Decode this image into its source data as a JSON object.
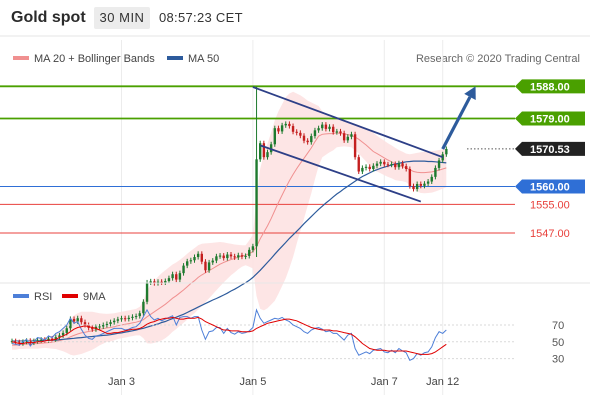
{
  "header": {
    "instrument": "Gold spot",
    "timeframe": "30 MIN",
    "time": "08:57:23 CET"
  },
  "legend": {
    "ma20_bb": "MA 20 + Bollinger Bands",
    "ma50": "MA 50",
    "research": "Research © 2020 Trading Central"
  },
  "rsi_legend": {
    "rsi": "RSI",
    "ma9": "9MA"
  },
  "colors": {
    "resistance": "#4aa000",
    "support_blue": "#2f6fd6",
    "support_red": "#e8413c",
    "candle_up": "#1e7a2e",
    "candle_down": "#c41e1e",
    "ma20": "#f09090",
    "ma50": "#2d5b9c",
    "channel": "#2d3f87",
    "arrow": "#2d5b9c",
    "bollinger_fill": "#fde1e1",
    "rsi_line": "#4d7fd8",
    "rsi_ma": "#e00000"
  },
  "chart_data": [
    {
      "type": "candlestick",
      "title": "Gold spot",
      "ylim": [
        1535,
        1592
      ],
      "levels": [
        {
          "value": 1588.0,
          "label": "1588.00",
          "kind": "resistance"
        },
        {
          "value": 1579.0,
          "label": "1579.00",
          "kind": "resistance"
        },
        {
          "value": 1570.53,
          "label": "1570.53",
          "kind": "last"
        },
        {
          "value": 1560.0,
          "label": "1560.00",
          "kind": "support_blue"
        },
        {
          "value": 1555.0,
          "label": "1555.00",
          "kind": "support_red"
        },
        {
          "value": 1547.0,
          "label": "1547.00",
          "kind": "support_red"
        }
      ],
      "x_ticks": [
        {
          "index": 30,
          "label": "Jan 3"
        },
        {
          "index": 66,
          "label": "Jan 5"
        },
        {
          "index": 102,
          "label": "Jan 7"
        },
        {
          "index": 118,
          "label": "Jan 12"
        }
      ],
      "close": [
        1516.8,
        1516.5,
        1516.2,
        1516.6,
        1516.9,
        1516.4,
        1516.8,
        1517.0,
        1517.2,
        1517.0,
        1517.5,
        1517.3,
        1517.9,
        1518.4,
        1519.1,
        1520.4,
        1523.0,
        1522.3,
        1523.2,
        1522.1,
        1521.3,
        1520.5,
        1520.1,
        1520.8,
        1520.9,
        1521.3,
        1521.6,
        1522.1,
        1522.5,
        1522.9,
        1523.2,
        1523.0,
        1523.3,
        1523.6,
        1523.8,
        1524.6,
        1527.8,
        1533.2,
        1533.5,
        1533.0,
        1533.4,
        1533.2,
        1533.6,
        1534.4,
        1535.5,
        1534.0,
        1535.8,
        1537.9,
        1539.1,
        1539.4,
        1540.3,
        1541.2,
        1539.0,
        1536.6,
        1538.8,
        1539.3,
        1540.5,
        1540.7,
        1540.0,
        1541.0,
        1540.5,
        1540.2,
        1540.8,
        1540.4,
        1540.6,
        1542.3,
        1543.3,
        1567.6,
        1572.1,
        1568.2,
        1569.6,
        1571.8,
        1576.3,
        1575.4,
        1577.1,
        1577.5,
        1576.9,
        1575.3,
        1575.0,
        1574.2,
        1572.8,
        1572.4,
        1574.1,
        1575.7,
        1576.3,
        1577.3,
        1576.1,
        1576.7,
        1575.2,
        1575.4,
        1574.9,
        1572.9,
        1573.9,
        1574.6,
        1568.2,
        1564.2,
        1565.2,
        1565.5,
        1564.9,
        1565.8,
        1566.4,
        1566.9,
        1566.2,
        1566.1,
        1566.3,
        1565.4,
        1566.5,
        1565.7,
        1564.9,
        1560.1,
        1559.3,
        1560.7,
        1560.2,
        1560.8,
        1561.4,
        1562.7,
        1565.2,
        1567.3,
        1569.0,
        1570.5
      ],
      "ma20": [
        1515.7,
        1515.7,
        1515.8,
        1515.9,
        1516.0,
        1516.0,
        1516.1,
        1516.1,
        1516.2,
        1516.3,
        1516.4,
        1516.5,
        1516.7,
        1516.9,
        1517.2,
        1517.5,
        1518.0,
        1518.4,
        1518.8,
        1519.1,
        1519.3,
        1519.5,
        1519.7,
        1519.9,
        1520.1,
        1520.3,
        1520.5,
        1520.6,
        1520.8,
        1521.1,
        1521.3,
        1521.5,
        1521.7,
        1521.9,
        1522.1,
        1522.4,
        1522.8,
        1523.6,
        1524.3,
        1525.0,
        1525.7,
        1526.4,
        1527.1,
        1527.9,
        1528.8,
        1529.5,
        1530.3,
        1531.1,
        1532.0,
        1532.9,
        1533.7,
        1534.6,
        1535.3,
        1535.9,
        1536.5,
        1537.1,
        1537.7,
        1538.3,
        1538.8,
        1539.2,
        1539.6,
        1539.9,
        1540.3,
        1540.6,
        1540.8,
        1541.3,
        1541.8,
        1543.2,
        1545.4,
        1547.2,
        1549.0,
        1551.0,
        1553.3,
        1555.5,
        1557.6,
        1559.7,
        1561.6,
        1563.4,
        1565.0,
        1566.5,
        1567.9,
        1569.3,
        1570.8,
        1572.5,
        1574.1,
        1574.6,
        1574.7,
        1574.8,
        1574.8,
        1575.0,
        1574.8,
        1574.7,
        1574.5,
        1574.3,
        1573.8,
        1573.2,
        1572.4,
        1571.6,
        1570.7,
        1569.8,
        1569.2,
        1568.6,
        1568.0,
        1567.4,
        1566.9,
        1566.3,
        1565.9,
        1565.6,
        1565.2,
        1564.7,
        1564.2,
        1564.0,
        1563.9,
        1563.9,
        1564.0,
        1564.1,
        1564.3,
        1564.6,
        1564.9,
        1565.2
      ],
      "bb_upper": [
        1517.0,
        1517.0,
        1517.0,
        1517.2,
        1517.3,
        1517.3,
        1517.5,
        1517.5,
        1517.6,
        1517.7,
        1518.0,
        1518.3,
        1518.8,
        1519.5,
        1520.4,
        1521.5,
        1523.0,
        1524.0,
        1524.6,
        1525.0,
        1525.0,
        1525.0,
        1525.0,
        1524.8,
        1524.6,
        1524.5,
        1524.4,
        1524.5,
        1524.6,
        1524.8,
        1525.0,
        1525.2,
        1525.4,
        1525.6,
        1525.8,
        1526.4,
        1528.0,
        1531.0,
        1532.5,
        1533.7,
        1534.8,
        1535.8,
        1536.6,
        1537.4,
        1538.2,
        1538.8,
        1539.5,
        1540.3,
        1541.2,
        1542.0,
        1542.8,
        1543.6,
        1544.0,
        1544.1,
        1544.2,
        1544.3,
        1544.4,
        1544.5,
        1544.4,
        1544.2,
        1544.0,
        1543.8,
        1543.7,
        1543.6,
        1543.6,
        1545.0,
        1546.5,
        1557.0,
        1565.0,
        1569.0,
        1572.0,
        1575.0,
        1578.5,
        1581.0,
        1583.0,
        1585.0,
        1586.0,
        1586.5,
        1586.0,
        1585.5,
        1584.8,
        1584.0,
        1583.5,
        1583.0,
        1582.5,
        1581.0,
        1580.5,
        1580.0,
        1579.5,
        1579.0,
        1578.5,
        1578.2,
        1577.9,
        1577.6,
        1577.5,
        1577.2,
        1576.7,
        1576.2,
        1575.6,
        1575.0,
        1574.2,
        1573.5,
        1572.8,
        1572.1,
        1571.5,
        1570.8,
        1570.2,
        1569.7,
        1569.2,
        1569.0,
        1569.2,
        1569.4,
        1569.6,
        1569.7,
        1569.8,
        1569.9,
        1570.0,
        1570.2,
        1570.4,
        1570.6
      ],
      "bb_lower": [
        1514.4,
        1514.4,
        1514.6,
        1514.6,
        1514.7,
        1514.7,
        1514.7,
        1514.7,
        1514.8,
        1514.9,
        1514.8,
        1514.7,
        1514.6,
        1514.3,
        1514.0,
        1513.5,
        1513.0,
        1512.8,
        1513.0,
        1513.2,
        1513.6,
        1514.0,
        1514.4,
        1515.0,
        1515.6,
        1516.1,
        1516.6,
        1516.7,
        1517.0,
        1517.4,
        1517.6,
        1517.8,
        1518.0,
        1518.2,
        1518.4,
        1518.4,
        1517.6,
        1516.2,
        1516.1,
        1516.3,
        1516.6,
        1517.0,
        1517.6,
        1518.4,
        1519.4,
        1520.2,
        1521.1,
        1521.9,
        1522.8,
        1523.8,
        1524.6,
        1525.6,
        1526.6,
        1527.7,
        1528.8,
        1529.9,
        1531.0,
        1532.1,
        1533.2,
        1534.2,
        1535.2,
        1536.0,
        1536.9,
        1537.6,
        1538.0,
        1537.6,
        1537.1,
        1529.4,
        1525.8,
        1525.4,
        1526.0,
        1527.0,
        1528.1,
        1530.0,
        1532.2,
        1534.4,
        1537.2,
        1540.3,
        1544.0,
        1547.5,
        1551.0,
        1554.6,
        1558.1,
        1562.0,
        1565.7,
        1568.2,
        1568.9,
        1569.6,
        1570.1,
        1571.0,
        1571.1,
        1571.2,
        1571.1,
        1571.0,
        1570.1,
        1569.2,
        1568.1,
        1567.0,
        1565.8,
        1564.6,
        1564.2,
        1563.7,
        1563.2,
        1562.7,
        1562.3,
        1561.8,
        1561.6,
        1561.5,
        1561.2,
        1560.4,
        1559.2,
        1558.6,
        1558.2,
        1558.1,
        1558.2,
        1558.3,
        1558.6,
        1559.0,
        1559.4,
        1559.8
      ],
      "ma50": [
        1516.8,
        1516.8,
        1516.8,
        1516.8,
        1516.8,
        1516.8,
        1516.9,
        1516.9,
        1516.9,
        1517.0,
        1517.0,
        1517.1,
        1517.1,
        1517.2,
        1517.3,
        1517.4,
        1517.5,
        1517.6,
        1517.7,
        1517.8,
        1517.9,
        1518.0,
        1518.1,
        1518.2,
        1518.3,
        1518.4,
        1518.5,
        1518.6,
        1518.8,
        1519.0,
        1519.1,
        1519.3,
        1519.5,
        1519.7,
        1519.9,
        1520.2,
        1520.4,
        1520.7,
        1521.0,
        1521.3,
        1521.6,
        1522.0,
        1522.3,
        1522.7,
        1523.1,
        1523.5,
        1523.9,
        1524.3,
        1524.8,
        1525.3,
        1525.8,
        1526.3,
        1526.8,
        1527.3,
        1527.8,
        1528.3,
        1528.7,
        1529.2,
        1529.7,
        1530.2,
        1530.8,
        1531.3,
        1531.9,
        1532.5,
        1533.1,
        1533.8,
        1534.6,
        1535.6,
        1536.6,
        1537.7,
        1538.8,
        1539.9,
        1541.1,
        1542.2,
        1543.3,
        1544.4,
        1545.5,
        1546.5,
        1547.5,
        1548.5,
        1549.6,
        1550.6,
        1551.6,
        1552.6,
        1553.6,
        1554.5,
        1555.4,
        1556.2,
        1557.1,
        1557.9,
        1558.6,
        1559.4,
        1560.1,
        1560.8,
        1561.5,
        1562.2,
        1562.8,
        1563.3,
        1563.8,
        1564.3,
        1564.7,
        1565.1,
        1565.4,
        1565.7,
        1566.0,
        1566.3,
        1566.5,
        1566.7,
        1566.9,
        1567.0,
        1567.1,
        1567.1,
        1567.1,
        1567.1,
        1567.0,
        1567.0,
        1566.9,
        1566.8,
        1566.7,
        1566.6
      ],
      "channel": {
        "upper": [
          [
            66,
            1587.8
          ],
          [
            118,
            1568.2
          ]
        ],
        "lower": [
          [
            68,
            1571.5
          ],
          [
            112,
            1555.8
          ]
        ]
      },
      "arrow": {
        "from": [
          118,
          1570.5
        ],
        "to": [
          127,
          1588.0
        ]
      }
    },
    {
      "type": "line",
      "title": "RSI",
      "ylim": [
        20,
        95
      ],
      "y_ticks": [
        30,
        50,
        70
      ],
      "series": [
        {
          "name": "RSI",
          "values": [
            48,
            47,
            46,
            50,
            53,
            45,
            50,
            55,
            54,
            52,
            57,
            55,
            60,
            62,
            66,
            70,
            78,
            72,
            74,
            65,
            58,
            54,
            53,
            57,
            58,
            60,
            62,
            64,
            66,
            66,
            66,
            64,
            65,
            67,
            68,
            72,
            80,
            88,
            80,
            76,
            78,
            75,
            77,
            79,
            81,
            70,
            79,
            80,
            80,
            78,
            80,
            80,
            64,
            53,
            62,
            63,
            67,
            67,
            60,
            66,
            61,
            59,
            62,
            60,
            61,
            63,
            67,
            88,
            78,
            72,
            74,
            76,
            78,
            77,
            79,
            76,
            74,
            70,
            68,
            66,
            62,
            60,
            64,
            66,
            67,
            65,
            62,
            63,
            60,
            60,
            56,
            52,
            58,
            60,
            42,
            34,
            36,
            38,
            36,
            40,
            41,
            42,
            38,
            37,
            40,
            37,
            42,
            39,
            37,
            28,
            30,
            36,
            34,
            37,
            38,
            44,
            55,
            62,
            60,
            64
          ]
        },
        {
          "name": "9MA",
          "values": [
            50,
            49,
            48,
            48,
            49,
            49,
            49,
            50,
            50,
            51,
            52,
            52,
            53,
            55,
            57,
            59,
            62,
            65,
            67,
            68,
            69,
            68,
            67,
            66,
            64,
            62,
            60,
            60,
            61,
            61,
            62,
            63,
            64,
            65,
            65,
            66,
            68,
            71,
            73,
            74,
            76,
            77,
            78,
            78,
            79,
            78,
            77,
            77,
            78,
            78,
            78,
            79,
            77,
            74,
            72,
            70,
            68,
            66,
            64,
            64,
            63,
            63,
            63,
            62,
            62,
            62,
            63,
            66,
            68,
            70,
            72,
            73,
            74,
            75,
            76,
            77,
            77,
            76,
            75,
            73,
            71,
            69,
            67,
            66,
            65,
            64,
            64,
            64,
            63,
            63,
            62,
            61,
            60,
            59,
            56,
            52,
            48,
            45,
            42,
            41,
            40,
            40,
            40,
            39,
            39,
            39,
            39,
            39,
            39,
            38,
            37,
            36,
            35,
            35,
            35,
            36,
            38,
            41,
            44,
            47
          ]
        }
      ],
      "x_ticks": [
        {
          "index": 30,
          "label": "Jan 3"
        },
        {
          "index": 66,
          "label": "Jan 5"
        },
        {
          "index": 102,
          "label": "Jan 7"
        },
        {
          "index": 118,
          "label": "Jan 12"
        }
      ]
    }
  ]
}
